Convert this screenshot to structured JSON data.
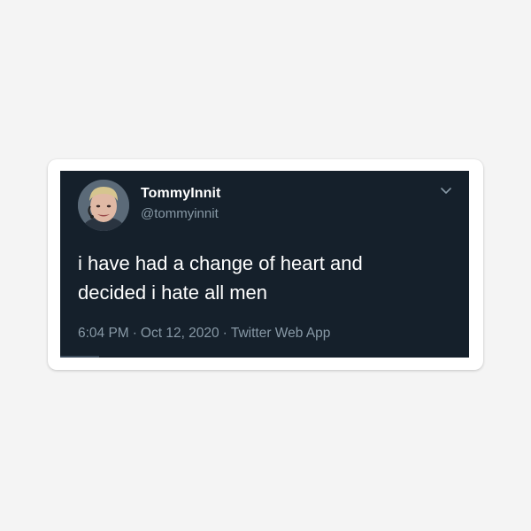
{
  "tweet": {
    "display_name": "TommyInnit",
    "handle": "@tommyinnit",
    "text_line1": "i have had a change of heart and",
    "text_line2": "decided i hate all men",
    "time": "6:04 PM",
    "separator": "·",
    "date": "Oct 12, 2020",
    "source": "Twitter Web App"
  },
  "icons": {
    "menu": "chevron-down-icon",
    "profile": "avatar"
  },
  "colors": {
    "card_background": "#15202b",
    "primary_text": "#ffffff",
    "secondary_text": "#8899a6",
    "sticker_border": "#ffffff",
    "page_background": "#f4f4f4"
  }
}
